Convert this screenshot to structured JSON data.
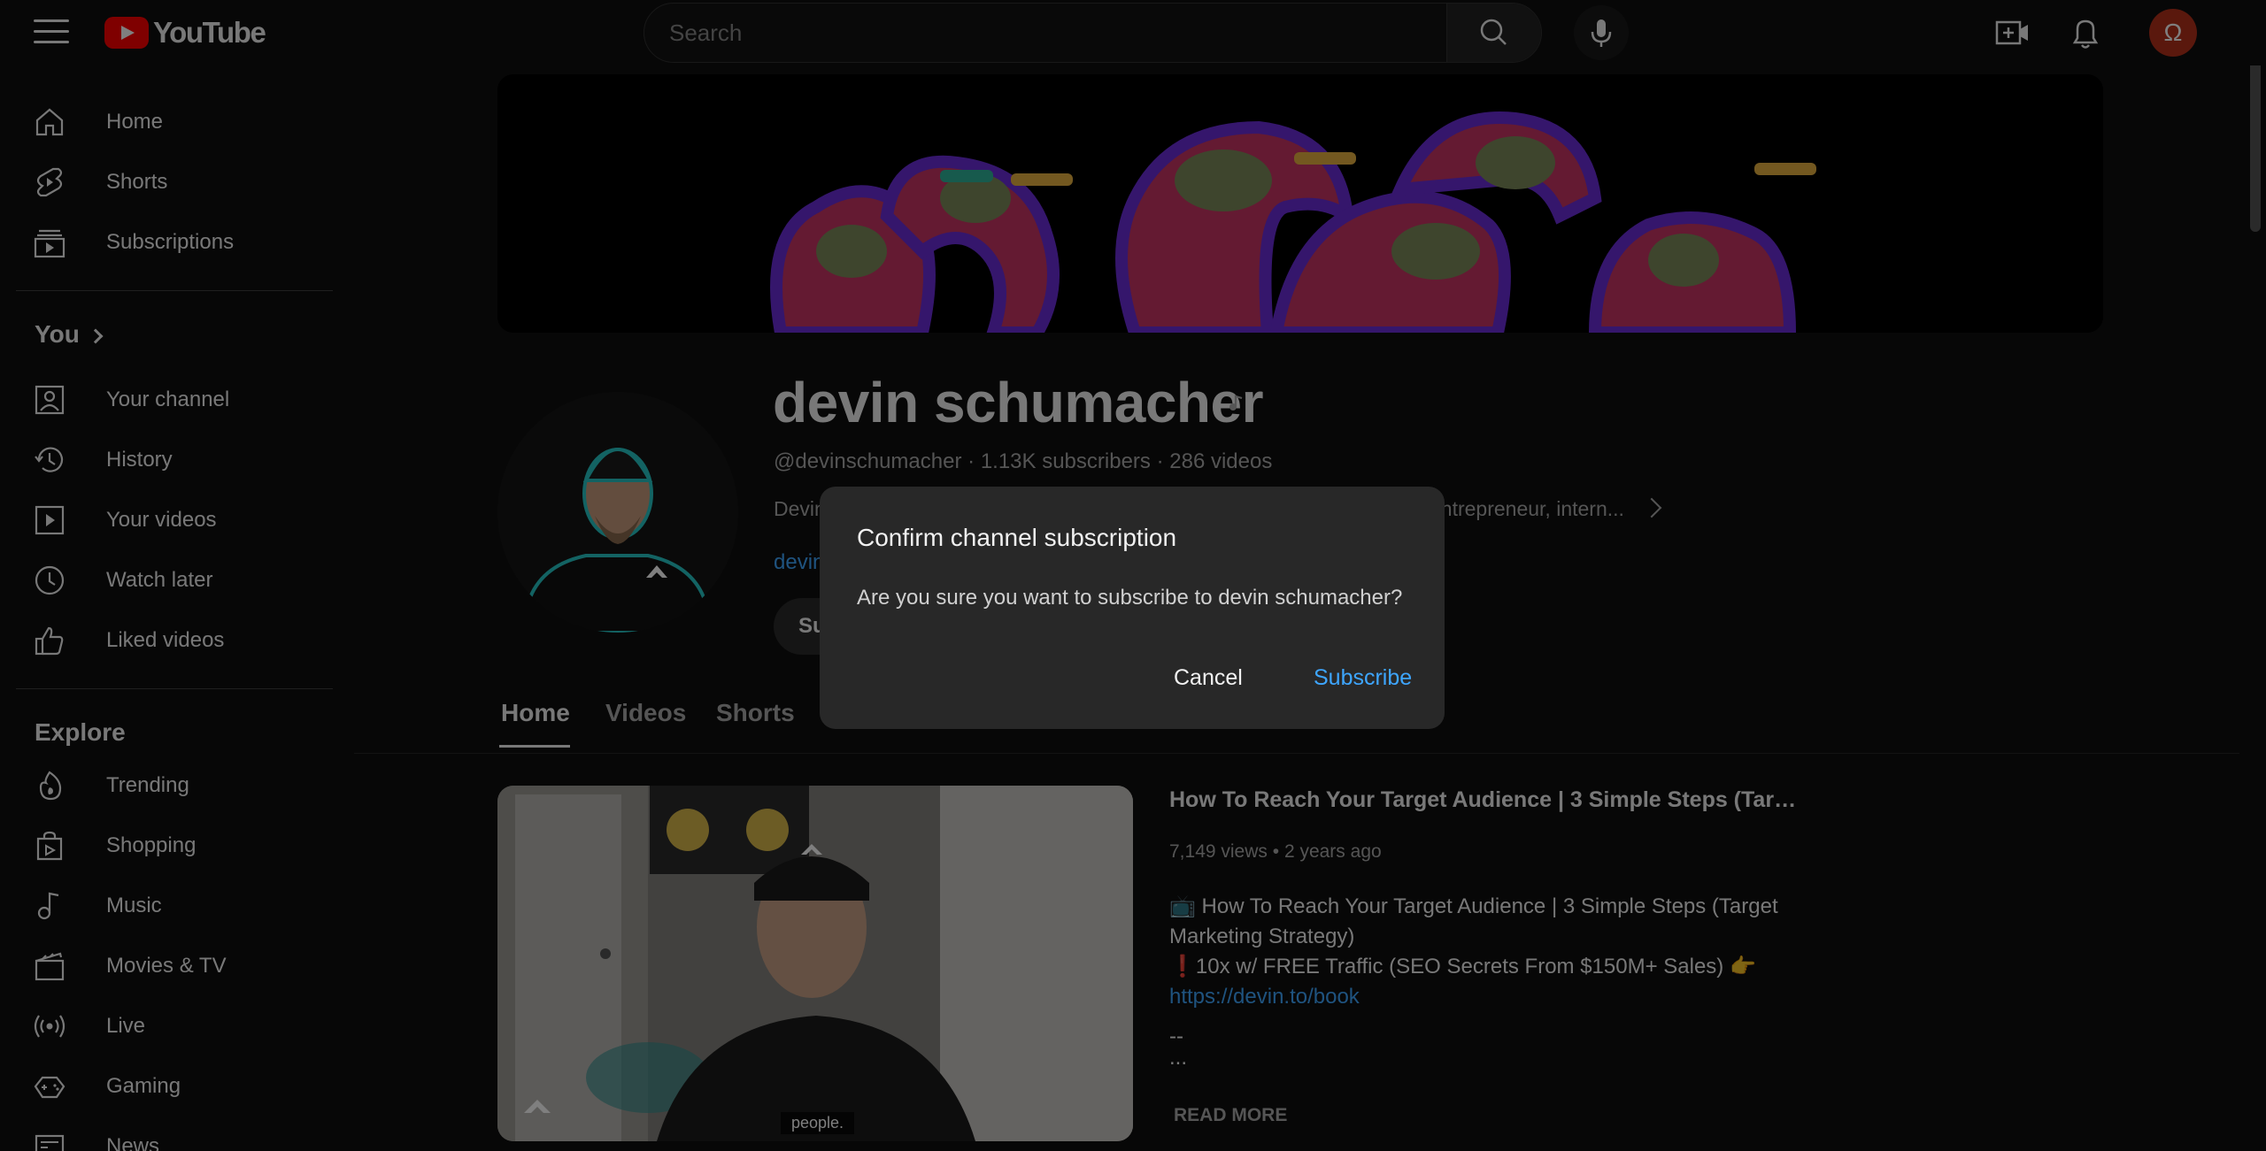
{
  "header": {
    "logo_text": "YouTube",
    "search_placeholder": "Search",
    "avatar_letter": "Ω"
  },
  "sidebar": {
    "main": [
      {
        "label": "Home",
        "icon": "home-icon"
      },
      {
        "label": "Shorts",
        "icon": "shorts-icon"
      },
      {
        "label": "Subscriptions",
        "icon": "subscriptions-icon"
      }
    ],
    "you_title": "You",
    "you_items": [
      {
        "label": "Your channel",
        "icon": "your-channel-icon"
      },
      {
        "label": "History",
        "icon": "history-icon"
      },
      {
        "label": "Your videos",
        "icon": "your-videos-icon"
      },
      {
        "label": "Watch later",
        "icon": "watch-later-icon"
      },
      {
        "label": "Liked videos",
        "icon": "liked-videos-icon"
      }
    ],
    "explore_title": "Explore",
    "explore_items": [
      {
        "label": "Trending",
        "icon": "trending-icon"
      },
      {
        "label": "Shopping",
        "icon": "shopping-icon"
      },
      {
        "label": "Music",
        "icon": "music-icon"
      },
      {
        "label": "Movies & TV",
        "icon": "movies-icon"
      },
      {
        "label": "Live",
        "icon": "live-icon"
      },
      {
        "label": "Gaming",
        "icon": "gaming-icon"
      },
      {
        "label": "News",
        "icon": "news-icon"
      }
    ]
  },
  "channel": {
    "name": "devin schumacher",
    "handle": "@devinschumacher",
    "subscribers": "1.13K subscribers",
    "videos": "286 videos",
    "description_start": "Devin",
    "description_end": "entrepreneur, intern...",
    "link_partial": "devin",
    "subscribe_partial": "Su"
  },
  "tabs": [
    {
      "label": "Home",
      "active": true
    },
    {
      "label": "Videos",
      "active": false
    },
    {
      "label": "Shorts",
      "active": false
    }
  ],
  "featured_video": {
    "title": "How To Reach Your Target Audience | 3 Simple Steps (Target ...",
    "views": "7,149 views",
    "age": "2 years ago",
    "desc_line1": "📺 How To Reach Your Target Audience | 3 Simple Steps (Target",
    "desc_line2": "Marketing Strategy)",
    "desc_line3": "❗10x w/ FREE Traffic (SEO Secrets From $150M+ Sales) 👉",
    "desc_link": "https://devin.to/book",
    "desc_line5": "--",
    "desc_line6": "...",
    "read_more": "READ MORE",
    "caption": "people."
  },
  "dialog": {
    "title": "Confirm channel subscription",
    "text": "Are you sure you want to subscribe to devin schumacher?",
    "cancel": "Cancel",
    "subscribe": "Subscribe"
  },
  "colors": {
    "background": "#0f0f0f",
    "dialog": "#282828",
    "accent_link": "#3ea6ff",
    "brand_red": "#ff0000",
    "avatar_red": "#b5301b"
  }
}
